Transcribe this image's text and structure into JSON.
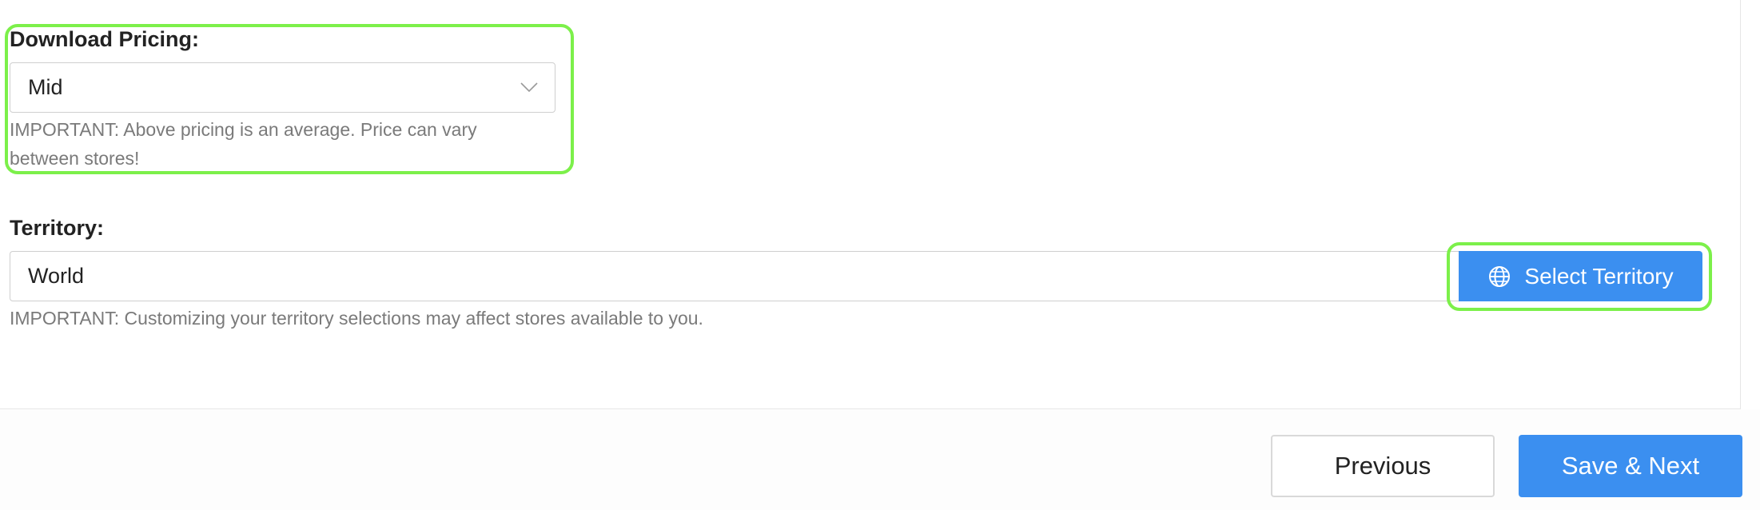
{
  "pricing": {
    "label": "Download Pricing:",
    "selected_value": "Mid",
    "help_line1": "IMPORTANT: Above pricing is an average. Price can vary",
    "help_line2": "between stores!"
  },
  "territory": {
    "label": "Territory:",
    "value": "World",
    "button_label": "Select Territory",
    "button_icon": "globe-icon",
    "help": "IMPORTANT: Customizing your territory selections may affect stores available to you."
  },
  "footer": {
    "previous_label": "Previous",
    "next_label": "Save & Next"
  },
  "colors": {
    "accent": "#3b8ff0",
    "highlight": "#7cf04a",
    "muted_text": "#7a7a7a"
  }
}
